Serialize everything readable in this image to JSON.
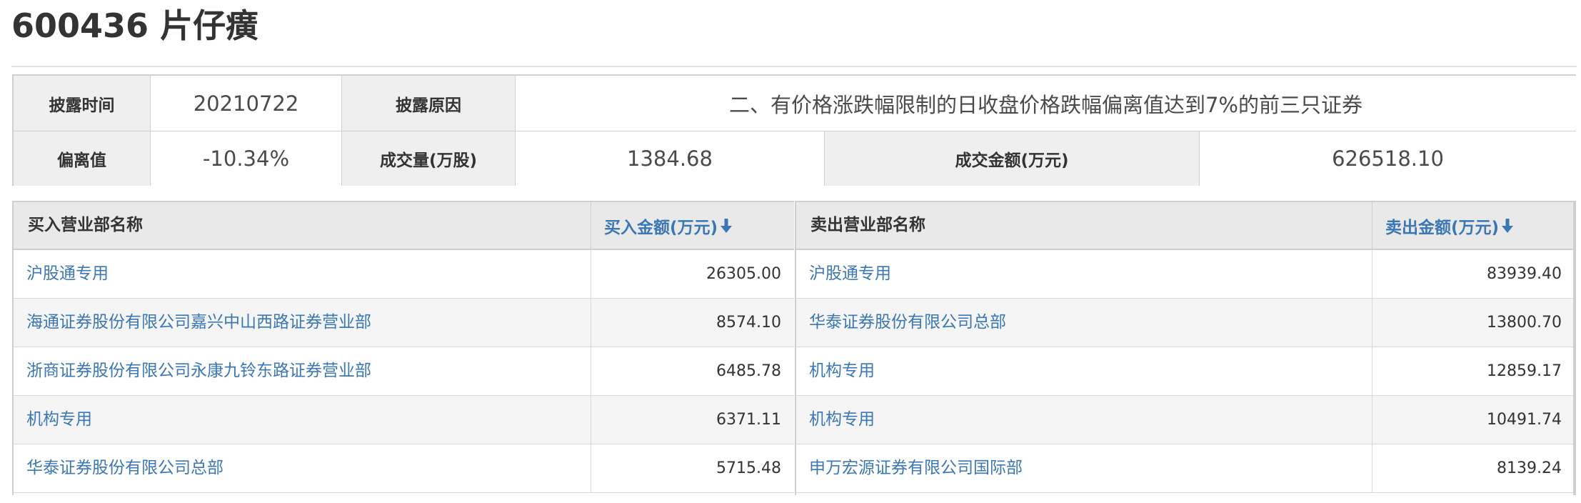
{
  "page": {
    "title": "600436 片仔癀"
  },
  "info": {
    "disclosure_time_label": "披露时间",
    "disclosure_time_value": "20210722",
    "disclosure_reason_label": "披露原因",
    "disclosure_reason_value": "二、有价格涨跌幅限制的日收盘价格跌幅偏离值达到7%的前三只证券",
    "deviation_label": "偏离值",
    "deviation_value": "-10.34%",
    "volume_label": "成交量(万股)",
    "volume_value": "1384.68",
    "turnover_label": "成交金额(万元)",
    "turnover_value": "626518.10"
  },
  "buy_table": {
    "name_header": "买入营业部名称",
    "amount_header": "买入金额(万元)",
    "sort_icon": "arrow-down-icon",
    "rows": [
      {
        "name": "沪股通专用",
        "amount": "26305.00"
      },
      {
        "name": "海通证券股份有限公司嘉兴中山西路证券营业部",
        "amount": "8574.10"
      },
      {
        "name": "浙商证券股份有限公司永康九铃东路证券营业部",
        "amount": "6485.78"
      },
      {
        "name": "机构专用",
        "amount": "6371.11"
      },
      {
        "name": "华泰证券股份有限公司总部",
        "amount": "5715.48"
      }
    ]
  },
  "sell_table": {
    "name_header": "卖出营业部名称",
    "amount_header": "卖出金额(万元)",
    "sort_icon": "arrow-down-icon",
    "rows": [
      {
        "name": "沪股通专用",
        "amount": "83939.40"
      },
      {
        "name": "华泰证券股份有限公司总部",
        "amount": "13800.70"
      },
      {
        "name": "机构专用",
        "amount": "12859.17"
      },
      {
        "name": "机构专用",
        "amount": "10491.74"
      },
      {
        "name": "申万宏源证券有限公司国际部",
        "amount": "8139.24"
      }
    ]
  },
  "colors": {
    "link_blue": "#3b77b5",
    "header_gray": "#efefef",
    "border_gray": "#cfcfcf",
    "text_dark": "#333333"
  }
}
